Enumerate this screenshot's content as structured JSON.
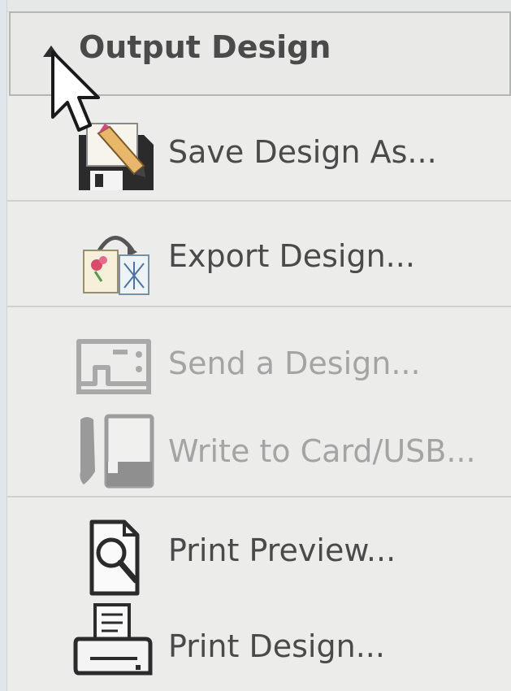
{
  "section": {
    "title": "Output Design",
    "expanded_icon": "collapse-arrow-up"
  },
  "items": [
    {
      "label": "Save Design As...",
      "icon": "save-design-icon",
      "enabled": true
    },
    {
      "label": "Export Design...",
      "icon": "export-design-icon",
      "enabled": true
    },
    {
      "label": "Send a Design...",
      "icon": "sewing-machine-icon",
      "enabled": false
    },
    {
      "label": "Write to Card/USB...",
      "icon": "card-usb-icon",
      "enabled": false
    },
    {
      "label": "Print Preview...",
      "icon": "print-preview-icon",
      "enabled": true
    },
    {
      "label": "Print Design...",
      "icon": "printer-icon",
      "enabled": true
    }
  ],
  "colors": {
    "panel_bg": "#ececeb",
    "text_enabled": "#4a4a4a",
    "text_disabled": "#a4a4a4",
    "header_border": "#b4b6b6"
  }
}
